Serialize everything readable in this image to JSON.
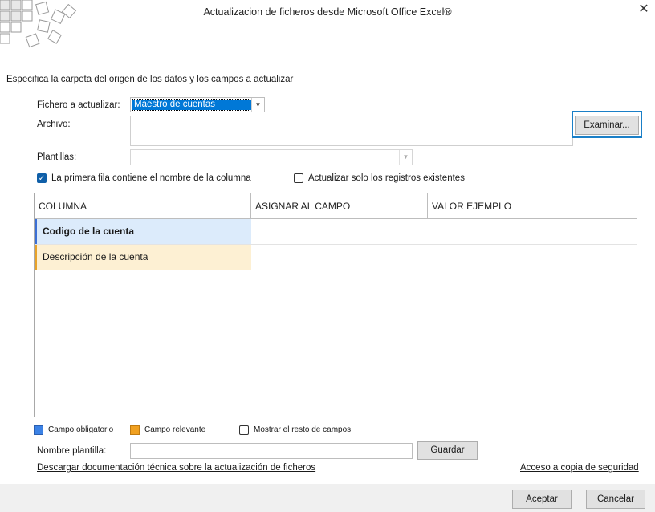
{
  "window": {
    "title": "Actualizacion de ficheros desde Microsoft Office Excel®",
    "close_glyph": "✕"
  },
  "header": {
    "instructions": "Especifica la carpeta del origen de los datos y los campos a actualizar"
  },
  "form": {
    "fichero_label": "Fichero a actualizar:",
    "fichero_value": "Maestro de cuentas",
    "archivo_label": "Archivo:",
    "archivo_value": "",
    "examinar_label": "Examinar...",
    "plantillas_label": "Plantillas:",
    "plantillas_value": "",
    "first_row_label": "La primera fila contiene el nombre de la columna",
    "first_row_checked": true,
    "update_existing_label": "Actualizar solo los registros existentes",
    "update_existing_checked": false
  },
  "grid": {
    "columns": [
      "COLUMNA",
      "ASIGNAR AL CAMPO",
      "VALOR EJEMPLO"
    ],
    "rows": [
      {
        "columna": "Codigo de la cuenta",
        "asignar": "",
        "valor": "",
        "type": "obligatorio"
      },
      {
        "columna": "Descripción de la cuenta",
        "asignar": "",
        "valor": "",
        "type": "relevante"
      }
    ]
  },
  "legend": {
    "obligatorio_label": "Campo obligatorio",
    "obligatorio_color": "#3b82e6",
    "relevante_label": "Campo relevante",
    "relevante_color": "#f0a020",
    "show_rest_label": "Mostrar el resto de campos",
    "show_rest_checked": false
  },
  "template": {
    "name_label": "Nombre plantilla:",
    "name_value": "",
    "save_label": "Guardar"
  },
  "links": {
    "doc": "Descargar documentación técnica sobre la actualización de ficheros",
    "backup": "Acceso a copia de seguridad"
  },
  "footer": {
    "accept_label": "Aceptar",
    "cancel_label": "Cancelar"
  },
  "colors": {
    "row_obligatorio_bg": "#dcebfb",
    "row_relevante_bg": "#fdf0d3",
    "selection": "#0078d7",
    "focus_ring": "#1a7fc7"
  }
}
